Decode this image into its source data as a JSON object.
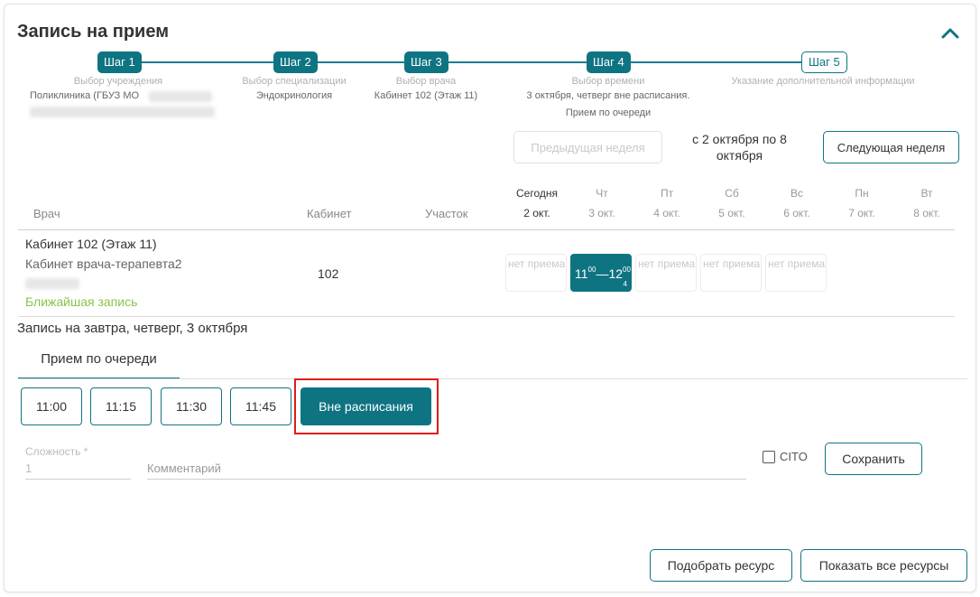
{
  "header": {
    "title": "Запись на прием"
  },
  "steps": [
    {
      "badge": "Шаг 1",
      "label": "Выбор учреждения",
      "value": "Поликлиника (ГБУЗ МО"
    },
    {
      "badge": "Шаг 2",
      "label": "Выбор специализации",
      "value": "Эндокринология"
    },
    {
      "badge": "Шаг 3",
      "label": "Выбор врача",
      "value": "Кабинет 102 (Этаж 11)"
    },
    {
      "badge": "Шаг 4",
      "label": "Выбор времени",
      "value": "3 октября, четверг вне расписания.",
      "value2": "Прием по очереди"
    },
    {
      "badge": "Шаг 5",
      "label": "Указание дополнительной информации",
      "value": ""
    }
  ],
  "week_nav": {
    "prev_label": "Предыдущая неделя",
    "range": "с 2 октября по 8 октября",
    "next_label": "Следующая неделя"
  },
  "table": {
    "col_doctor": "Врач",
    "col_cabinet": "Кабинет",
    "col_area": "Участок",
    "days": [
      {
        "name": "Сегодня",
        "date": "2 окт."
      },
      {
        "name": "Чт",
        "date": "3 окт."
      },
      {
        "name": "Пт",
        "date": "4 окт."
      },
      {
        "name": "Сб",
        "date": "5 окт."
      },
      {
        "name": "Вс",
        "date": "6 окт."
      },
      {
        "name": "Пн",
        "date": "7 окт."
      },
      {
        "name": "Вт",
        "date": "8 окт."
      }
    ],
    "row": {
      "name": "Кабинет 102 (Этаж 11)",
      "role": "Кабинет врача-терапевта2",
      "nearest": "Ближайшая запись",
      "cabinet": "102",
      "slots": {
        "no_reception": "нет приема",
        "active_from_h": "11",
        "active_from_m": "00",
        "active_dash": "—",
        "active_to_h": "12",
        "active_to_m": "00",
        "active_count": "4"
      }
    }
  },
  "booking": {
    "title": "Запись на завтра, четверг, 3 октября",
    "tab": "Прием по очереди",
    "times": [
      "11:00",
      "11:15",
      "11:30",
      "11:45"
    ],
    "off_schedule": "Вне расписания"
  },
  "form": {
    "complexity_label": "Сложность *",
    "complexity_value": "1",
    "comment_placeholder": "Комментарий",
    "cito_label": "CITO",
    "save_label": "Сохранить"
  },
  "footer": {
    "pick_resource": "Подобрать ресурс",
    "show_all_resources": "Показать все ресурсы"
  },
  "colors": {
    "accent": "#0f7482",
    "highlight": "#e01b1b",
    "nearest": "#8bc34a"
  }
}
